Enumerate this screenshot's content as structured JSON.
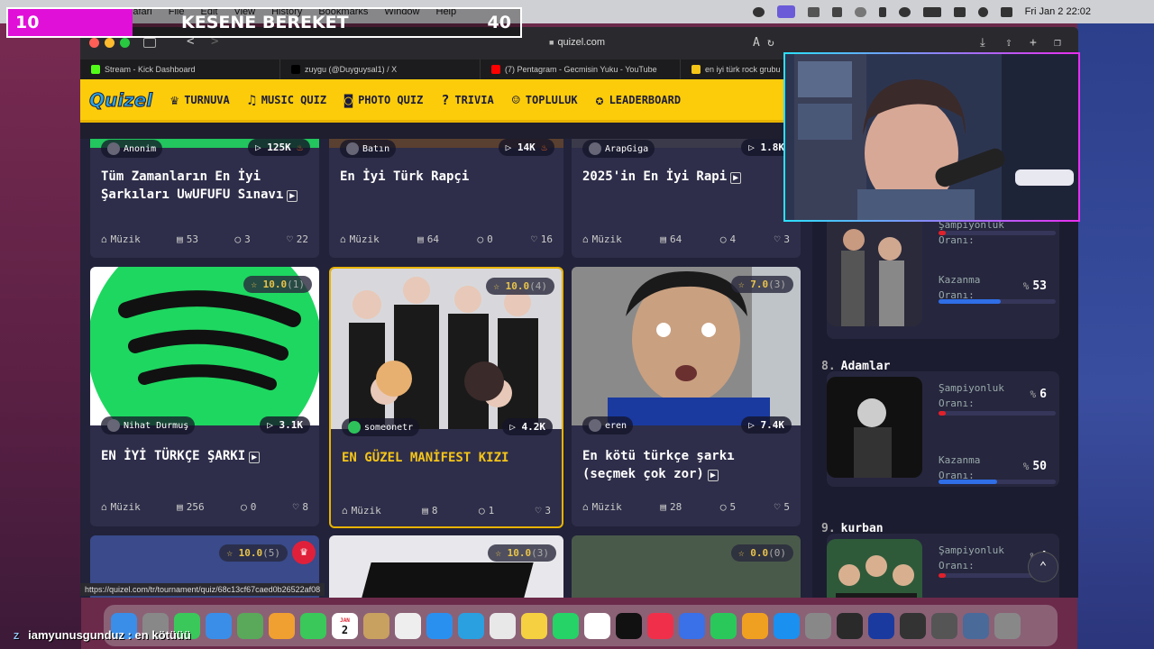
{
  "menubar": {
    "items": [
      "Safari",
      "File",
      "Edit",
      "View",
      "History",
      "Bookmarks",
      "Window",
      "Help"
    ],
    "clock": "Fri Jan 2  22:02"
  },
  "overlay": {
    "number": "10",
    "title": "KESENE BEREKET",
    "right_number": "40"
  },
  "browser": {
    "url": "quizel.com",
    "tabs": [
      {
        "label": "Stream - Kick Dashboard",
        "color": "#53fc18"
      },
      {
        "label": "zuygu (@Duyguysal1) / X",
        "color": "#000000"
      },
      {
        "label": "(7) Pentagram - Gecmisin Yuku - YouTube",
        "color": "#ff0000"
      },
      {
        "label": "en iyi türk rock grubu",
        "color": "#f5c518"
      }
    ],
    "status_url": "https://quizel.com/tr/tournament/quiz/68c13cf67caed0b26522af08"
  },
  "nav": {
    "logo": "Quizel",
    "items": [
      {
        "label": "TURNUVA",
        "icon": "trophy-icon",
        "glyph": "♛"
      },
      {
        "label": "MUSIC QUIZ",
        "icon": "music-icon",
        "glyph": "♫"
      },
      {
        "label": "PHOTO QUIZ",
        "icon": "camera-icon",
        "glyph": "◙"
      },
      {
        "label": "TRIVIA",
        "icon": "question-icon",
        "glyph": "?"
      },
      {
        "label": "TOPLULUK",
        "icon": "users-icon",
        "glyph": "☺"
      },
      {
        "label": "LEADERBOARD",
        "icon": "medal-icon",
        "glyph": "✪"
      }
    ]
  },
  "cards_row1": [
    {
      "author": "Anonim",
      "plays": "125K",
      "hot": true,
      "title": "Tüm Zamanların En İyi Şarkıları UwUFUFU Sınavı",
      "category": "Müzik",
      "items": "53",
      "comments": "3",
      "likes": "22",
      "video": true
    },
    {
      "author": "Batın",
      "plays": "14K",
      "hot": true,
      "title": "En İyi Türk Rapçi",
      "category": "Müzik",
      "items": "64",
      "comments": "0",
      "likes": "16",
      "video": false
    },
    {
      "author": "ArapGiga",
      "plays": "1.8K",
      "hot": false,
      "title": "2025'in En İyi Rapi",
      "category": "Müzik",
      "items": "64",
      "comments": "4",
      "likes": "3",
      "video": true
    }
  ],
  "cards_row2": [
    {
      "author": "Nihat Durmuş",
      "plays": "3.1K",
      "rating": "10.0",
      "rating_count": "(1)",
      "title": "EN İYİ TÜRKÇE ŞARKI",
      "category": "Müzik",
      "items": "256",
      "comments": "0",
      "likes": "8",
      "video": true
    },
    {
      "author": "someonetr",
      "plays": "4.2K",
      "rating": "10.0",
      "rating_count": "(4)",
      "title": "EN GÜZEL MANİFEST KIZI",
      "category": "Müzik",
      "items": "8",
      "comments": "1",
      "likes": "3",
      "video": false
    },
    {
      "author": "eren",
      "plays": "7.4K",
      "rating": "7.0",
      "rating_count": "(3)",
      "title": "En kötü türkçe şarkı (seçmek çok zor)",
      "category": "Müzik",
      "items": "28",
      "comments": "5",
      "likes": "5",
      "video": true
    }
  ],
  "cards_row3": [
    {
      "rating": "10.0",
      "rating_count": "(5)"
    },
    {
      "rating": "10.0",
      "rating_count": "(3)"
    },
    {
      "rating": "0.0",
      "rating_count": "(0)"
    }
  ],
  "leaderboard": {
    "champ_label_1": "Şampiyonluk",
    "champ_label_2": "Oranı:",
    "win_label_1": "Kazanma",
    "win_label_2": "Oranı:",
    "pct_sign": "%",
    "top": {
      "champ_pct": "6",
      "win_pct": "53",
      "champ_fraction": 0.06,
      "win_fraction": 0.53
    },
    "entries": [
      {
        "rank": "8.",
        "name": "Adamlar",
        "champ_pct": "6",
        "win_pct": "50",
        "champ_fraction": 0.06,
        "win_fraction": 0.5
      },
      {
        "rank": "9.",
        "name": "kurban",
        "champ_pct": "4",
        "champ_fraction": 0.04
      }
    ]
  },
  "chat": {
    "badge": "Z",
    "user": "iamyunusgunduz",
    "message": " : en kötüüü"
  },
  "dock": [
    "Finder",
    "Launchpad",
    "Messages",
    "Mail",
    "Maps",
    "Photos",
    "FaceTime",
    "Calendar",
    "Notes",
    "Reminders",
    "Safari",
    "Telegram",
    "Chrome",
    "Notes",
    "WhatsApp",
    "Freeform",
    "TV",
    "Music",
    "Keynote",
    "Numbers",
    "Pages",
    "App Store",
    "Settings",
    "Vectorize",
    "WD",
    "OBS",
    "QuickTime",
    "Folder",
    "Trash"
  ],
  "calendar_day": "2",
  "calendar_month": "JAN",
  "colors": {
    "accent": "#fccc0a",
    "bg": "#22223a",
    "card": "#2e2e4a",
    "red_bar": "#e0202a",
    "blue_bar": "#2f6ee6"
  }
}
